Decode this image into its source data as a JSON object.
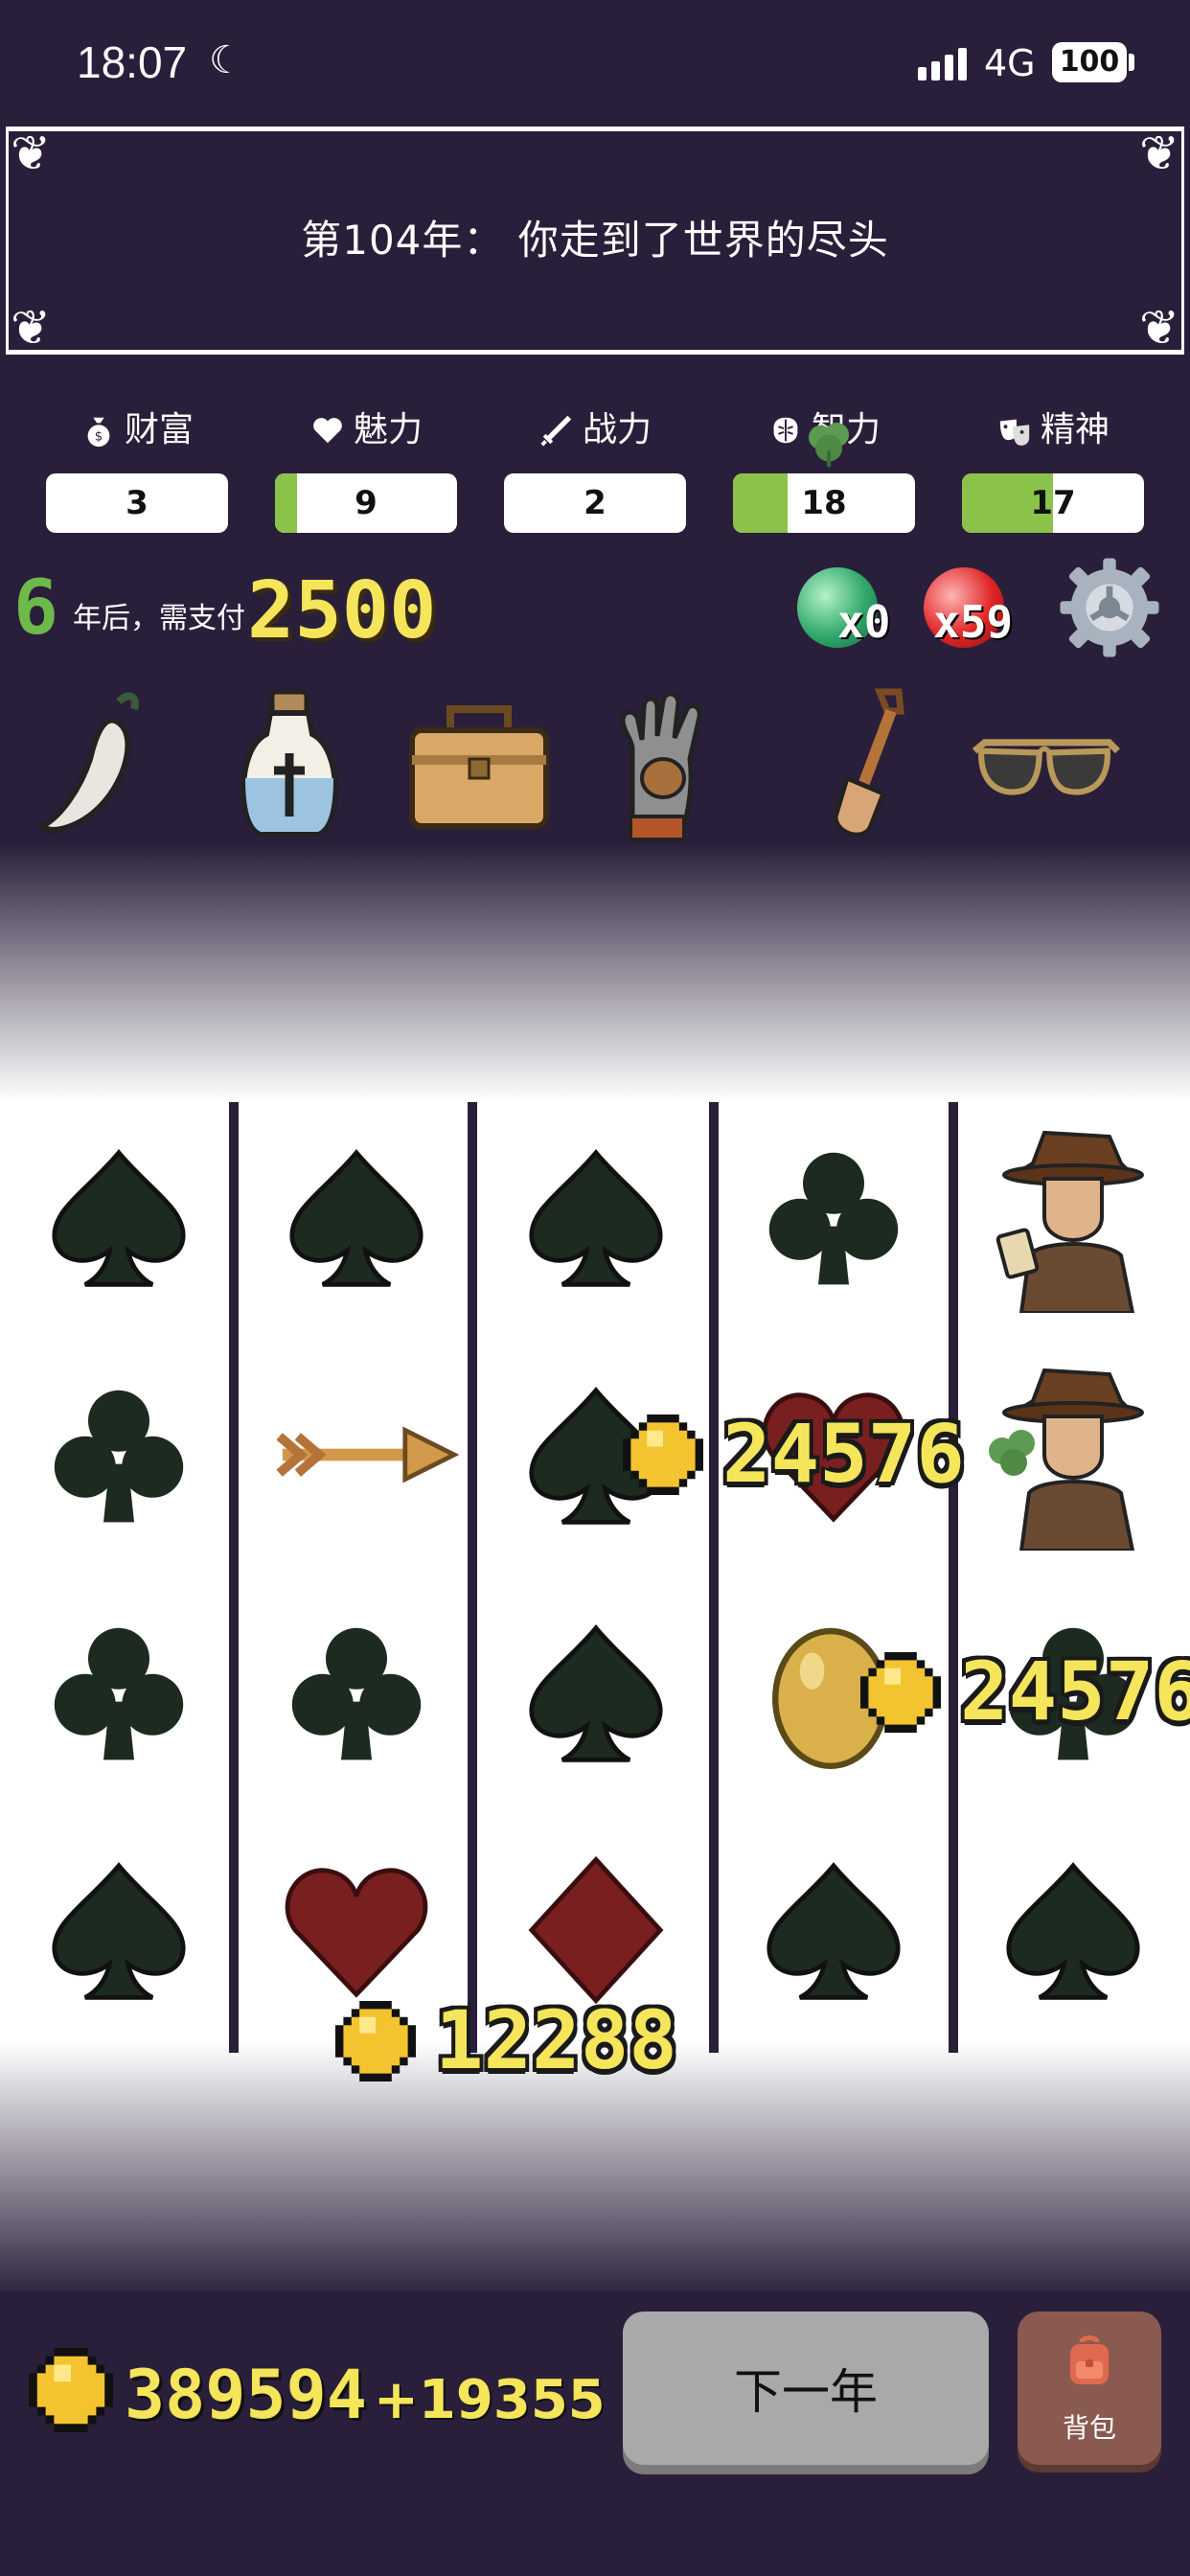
{
  "status_bar": {
    "time": "18:07",
    "network": "4G",
    "battery": "100"
  },
  "banner": {
    "title": "第104年：  你走到了世界的尽头"
  },
  "stats": [
    {
      "label": "财富",
      "value": "3",
      "icon": "money-bag-icon",
      "fill": 0
    },
    {
      "label": "魅力",
      "value": "9",
      "icon": "heart-icon",
      "fill": 0.12
    },
    {
      "label": "战力",
      "value": "2",
      "icon": "sword-icon",
      "fill": 0
    },
    {
      "label": "智力",
      "value": "18",
      "icon": "brain-icon",
      "fill": 0.3
    },
    {
      "label": "精神",
      "value": "17",
      "icon": "mask-icon",
      "fill": 0.5
    }
  ],
  "payment": {
    "years": "6",
    "text": "年后，需支付",
    "amount": "2500"
  },
  "orbs": {
    "green_count": "x0",
    "red_count": "x59"
  },
  "items": [
    "white-chili-icon",
    "holy-water-bottle-icon",
    "toolbox-icon",
    "glove-icon",
    "shovel-icon",
    "sunglasses-icon"
  ],
  "grid": {
    "columns": [
      [
        "spade",
        "club",
        "club",
        "spade"
      ],
      [
        "spade",
        "arrow",
        "club",
        "heart"
      ],
      [
        "spade",
        "spade",
        "spade",
        "diamond"
      ],
      [
        "club",
        "heart",
        "golden-egg",
        "spade"
      ],
      [
        "gambler",
        "gambler-clover",
        "club",
        "spade"
      ]
    ]
  },
  "floating_payouts": [
    {
      "value": "24576"
    },
    {
      "value": "24576"
    },
    {
      "value": "12288"
    }
  ],
  "footer": {
    "total_coins": "389594",
    "delta": "+19355",
    "next_label": "下一年",
    "bag_label": "背包"
  },
  "colors": {
    "background": "#2a1f3a",
    "stat_fill": "#8bc34a",
    "gold_text": "#f4e55a",
    "years_green": "#6dba4a",
    "spade_club": "#1c2a20",
    "heart_diamond": "#7a1f1f"
  }
}
